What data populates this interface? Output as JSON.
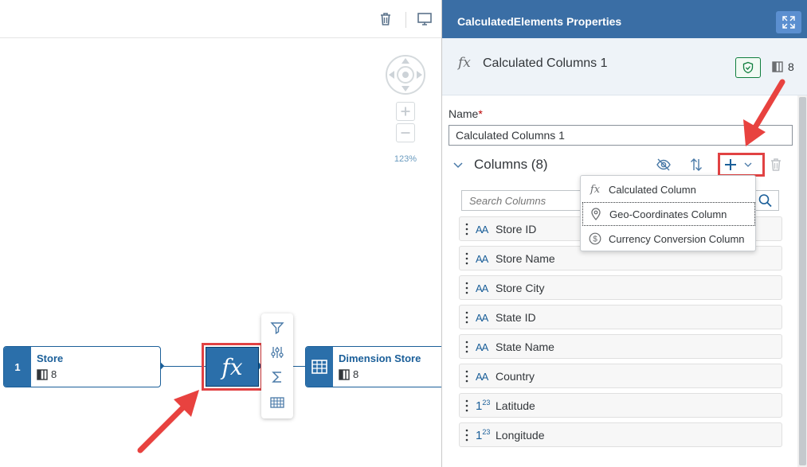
{
  "canvas": {
    "zoom_level": "123%",
    "nodes": {
      "store": {
        "index": "1",
        "title": "Store",
        "count": "8"
      },
      "dimension": {
        "title": "Dimension Store",
        "count": "8"
      },
      "calculated": {
        "symbol": "fx"
      }
    },
    "node_menu": [
      "filter-icon",
      "sliders-icon",
      "sigma-icon",
      "grid-icon"
    ]
  },
  "panel": {
    "title": "CalculatedElements Properties",
    "node_band": {
      "symbol": "fx",
      "name": "Calculated Columns 1",
      "column_count": "8"
    },
    "name_label": "Name",
    "name_required_mark": "*",
    "name_value": "Calculated Columns 1",
    "columns_title": "Columns (8)",
    "search_placeholder": "Search Columns",
    "columns": [
      {
        "type": "AA",
        "name": "Store ID"
      },
      {
        "type": "AA",
        "name": "Store Name"
      },
      {
        "type": "AA",
        "name": "Store City"
      },
      {
        "type": "AA",
        "name": "State ID"
      },
      {
        "type": "AA",
        "name": "State Name"
      },
      {
        "type": "AA",
        "name": "Country"
      },
      {
        "type": "123",
        "name": "Latitude"
      },
      {
        "type": "123",
        "name": "Longitude"
      }
    ]
  },
  "add_menu": {
    "items": [
      {
        "icon": "fx-icon",
        "label": "Calculated Column",
        "symbol": "fx"
      },
      {
        "icon": "location-pin-icon",
        "label": "Geo-Coordinates Column"
      },
      {
        "icon": "currency-icon",
        "label": "Currency Conversion Column"
      }
    ]
  },
  "colors": {
    "accent": "#2b6faa",
    "header": "#3a6ea5",
    "highlight_frame": "#e14243",
    "arrow": "#e8423f"
  }
}
